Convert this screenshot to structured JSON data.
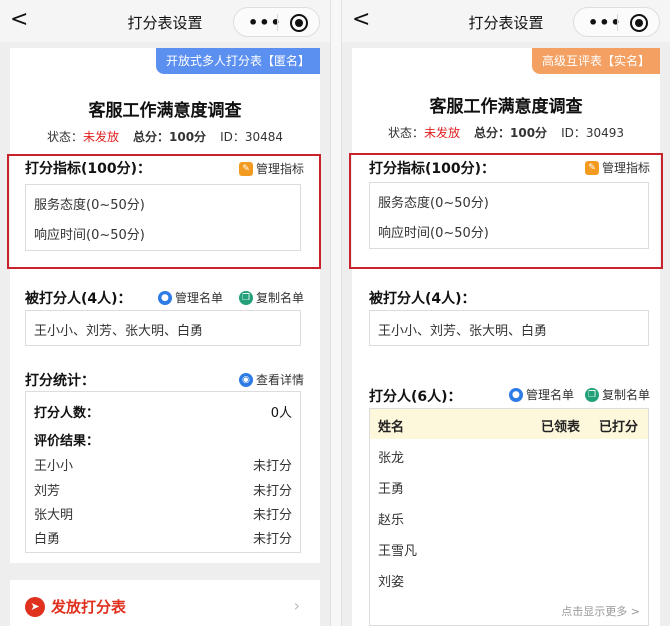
{
  "left": {
    "nav": {
      "back": "<",
      "title": "打分表设置"
    },
    "tag": "开放式多人打分表【匿名】",
    "survey_title": "客服工作满意度调查",
    "meta": {
      "status_label": "状态：",
      "status_value": "未发放",
      "total": "总分：100分",
      "id": "ID：30484"
    },
    "indicators": {
      "title": "打分指标(100分)：",
      "manage": "管理指标",
      "items": [
        "服务态度(0~50分)",
        "响应时间(0~50分)"
      ]
    },
    "scorees": {
      "title": "被打分人(4人)：",
      "manage": "管理名单",
      "copy": "复制名单",
      "names": "王小小、刘芳、张大明、白勇"
    },
    "stats": {
      "title": "打分统计：",
      "view": "查看详情",
      "count_label": "打分人数：",
      "count_value": "0人",
      "result_label": "评价结果：",
      "rows": [
        {
          "name": "王小小",
          "status": "未打分"
        },
        {
          "name": "刘芳",
          "status": "未打分"
        },
        {
          "name": "张大明",
          "status": "未打分"
        },
        {
          "name": "白勇",
          "status": "未打分"
        }
      ]
    },
    "dispatch": "发放打分表"
  },
  "right": {
    "nav": {
      "back": "<",
      "title": "打分表设置"
    },
    "tag": "高级互评表【实名】",
    "survey_title": "客服工作满意度调查",
    "meta": {
      "status_label": "状态：",
      "status_value": "未发放",
      "total": "总分：100分",
      "id": "ID：30493"
    },
    "indicators": {
      "title": "打分指标(100分)：",
      "manage": "管理指标",
      "items": [
        "服务态度(0~50分)",
        "响应时间(0~50分)"
      ]
    },
    "scorees": {
      "title": "被打分人(4人)：",
      "names": "王小小、刘芳、张大明、白勇"
    },
    "scorers": {
      "title": "打分人(6人)：",
      "manage": "管理名单",
      "copy": "复制名单",
      "headers": [
        "姓名",
        "已领表",
        "已打分"
      ],
      "names": [
        "张龙",
        "王勇",
        "赵乐",
        "王雪凡",
        "刘姿"
      ],
      "more": "点击显示更多 >"
    }
  },
  "colors": {
    "tag_left": "#5b8ff0",
    "tag_right": "#f4a063",
    "status_red": "#e02020",
    "frame_red": "#c8232c"
  }
}
